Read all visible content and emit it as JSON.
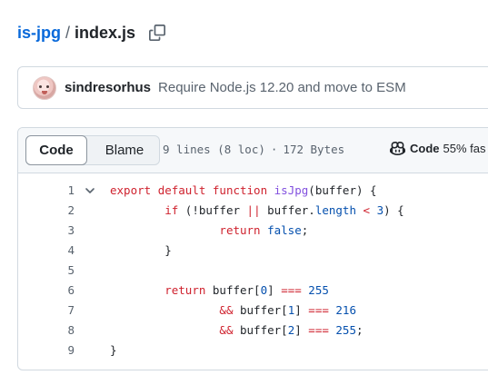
{
  "breadcrumb": {
    "repo": "is-jpg",
    "separator": "/",
    "file": "index.js",
    "copy_icon": "copy-icon"
  },
  "commit": {
    "author": "sindresorhus",
    "message": "Require Node.js 12.20 and move to ESM"
  },
  "file_header": {
    "tabs": {
      "code": "Code",
      "blame": "Blame"
    },
    "lines_info": "9 lines (8 loc)",
    "dot": "·",
    "size": "172 Bytes",
    "copilot_label": "Code",
    "copilot_pct": "55% fas"
  },
  "code": {
    "lines": [
      {
        "n": "1",
        "tokens": [
          {
            "t": "export",
            "c": "kw"
          },
          {
            "t": " "
          },
          {
            "t": "default",
            "c": "kw"
          },
          {
            "t": " "
          },
          {
            "t": "function",
            "c": "kw"
          },
          {
            "t": " "
          },
          {
            "t": "isJpg",
            "c": "fn"
          },
          {
            "t": "(buffer) {"
          }
        ]
      },
      {
        "n": "2",
        "tokens": [
          {
            "t": "\t"
          },
          {
            "t": "if",
            "c": "kw"
          },
          {
            "t": " (!buffer "
          },
          {
            "t": "||",
            "c": "kw"
          },
          {
            "t": " buffer."
          },
          {
            "t": "length",
            "c": "cst"
          },
          {
            "t": " "
          },
          {
            "t": "<",
            "c": "kw"
          },
          {
            "t": " "
          },
          {
            "t": "3",
            "c": "cst"
          },
          {
            "t": ") {"
          }
        ]
      },
      {
        "n": "3",
        "tokens": [
          {
            "t": "\t\t"
          },
          {
            "t": "return",
            "c": "kw"
          },
          {
            "t": " "
          },
          {
            "t": "false",
            "c": "cst"
          },
          {
            "t": ";"
          }
        ]
      },
      {
        "n": "4",
        "tokens": [
          {
            "t": "\t}"
          }
        ]
      },
      {
        "n": "5",
        "tokens": []
      },
      {
        "n": "6",
        "tokens": [
          {
            "t": "\t"
          },
          {
            "t": "return",
            "c": "kw"
          },
          {
            "t": " buffer["
          },
          {
            "t": "0",
            "c": "cst"
          },
          {
            "t": "] "
          },
          {
            "t": "===",
            "c": "kw"
          },
          {
            "t": " "
          },
          {
            "t": "255",
            "c": "cst"
          }
        ]
      },
      {
        "n": "7",
        "tokens": [
          {
            "t": "\t\t"
          },
          {
            "t": "&&",
            "c": "kw"
          },
          {
            "t": " buffer["
          },
          {
            "t": "1",
            "c": "cst"
          },
          {
            "t": "] "
          },
          {
            "t": "===",
            "c": "kw"
          },
          {
            "t": " "
          },
          {
            "t": "216",
            "c": "cst"
          }
        ]
      },
      {
        "n": "8",
        "tokens": [
          {
            "t": "\t\t"
          },
          {
            "t": "&&",
            "c": "kw"
          },
          {
            "t": " buffer["
          },
          {
            "t": "2",
            "c": "cst"
          },
          {
            "t": "] "
          },
          {
            "t": "===",
            "c": "kw"
          },
          {
            "t": " "
          },
          {
            "t": "255",
            "c": "cst"
          },
          {
            "t": ";"
          }
        ]
      },
      {
        "n": "9",
        "tokens": [
          {
            "t": "}"
          }
        ]
      }
    ]
  },
  "colors": {
    "link": "#0969da",
    "keyword": "#cf222e",
    "function": "#8250df",
    "constant": "#0550ae",
    "border": "#d1d9e0",
    "muted": "#59636e"
  }
}
